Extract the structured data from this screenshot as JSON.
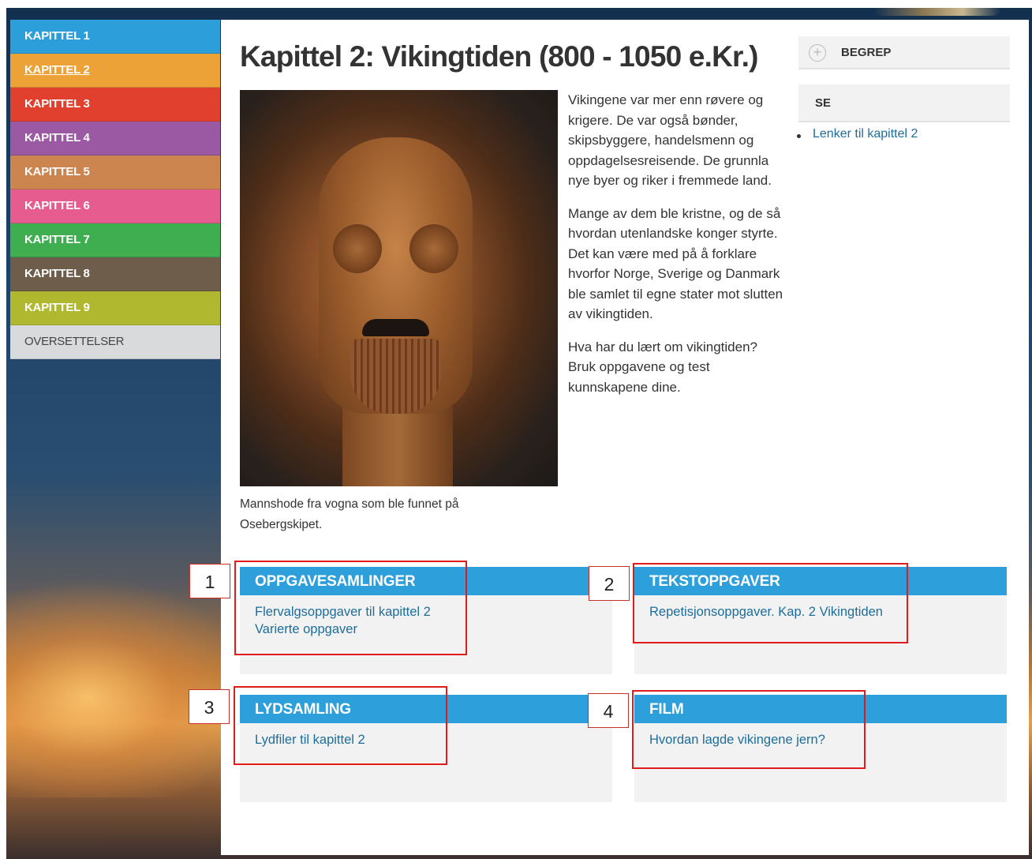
{
  "colors": {
    "kapittel_1": "#2c9fda",
    "kapittel_2": "#eca237",
    "kapittel_3": "#e2402e",
    "kapittel_4": "#9b59a3",
    "kapittel_5": "#cd8550",
    "kapittel_6": "#e65c8f",
    "kapittel_7": "#3fae50",
    "kapittel_8": "#6f5d4b",
    "kapittel_9": "#b0b830",
    "card_header": "#2d9fda",
    "link": "#1d6d9b",
    "annotation": "#e11b1b"
  },
  "sidebar": {
    "items": [
      {
        "label": "KAPITTEL 1"
      },
      {
        "label": "KAPITTEL 2"
      },
      {
        "label": "KAPITTEL 3"
      },
      {
        "label": "KAPITTEL 4"
      },
      {
        "label": "KAPITTEL 5"
      },
      {
        "label": "KAPITTEL 6"
      },
      {
        "label": "KAPITTEL 7"
      },
      {
        "label": "KAPITTEL 8"
      },
      {
        "label": "KAPITTEL 9"
      },
      {
        "label": "OVERSETTELSER"
      }
    ],
    "active": "KAPITTEL 2"
  },
  "main": {
    "title": "Kapittel 2: Vikingtiden (800 - 1050 e.Kr.)",
    "image_caption": "Mannshode fra vogna som ble funnet på Osebergskipet.",
    "paragraphs": [
      "Vikingene var mer enn røvere og krigere. De var også bønder, skipsbyggere, handelsmenn og oppdagelsesreisende. De grunnla nye byer og riker i fremmede land.",
      "Mange av dem ble kristne, og de så hvordan utenlandske konger styrte. Det kan være med på å forklare hvorfor Norge, Sverige og Danmark ble samlet til egne stater mot slutten av vikingtiden.",
      "Hva har du lært om vikingtiden? Bruk oppgavene og test kunnskapene dine."
    ]
  },
  "right": {
    "begrep_label": "BEGREP",
    "begrep_icon": "plus-circle-icon",
    "se_label": "SE",
    "se_links": [
      "Lenker til kapittel 2"
    ]
  },
  "cards": [
    {
      "title": "OPPGAVESAMLINGER",
      "links": [
        "Flervalgsoppgaver til kapittel 2",
        "Varierte oppgaver"
      ]
    },
    {
      "title": "TEKSTOPPGAVER",
      "links": [
        "Repetisjonsoppgaver. Kap. 2 Vikingtiden"
      ]
    },
    {
      "title": "LYDSAMLING",
      "links": [
        "Lydfiler til kapittel 2"
      ]
    },
    {
      "title": "FILM",
      "links": [
        "Hvordan lagde vikingene jern?"
      ]
    }
  ],
  "annotations": [
    "1",
    "2",
    "3",
    "4"
  ]
}
